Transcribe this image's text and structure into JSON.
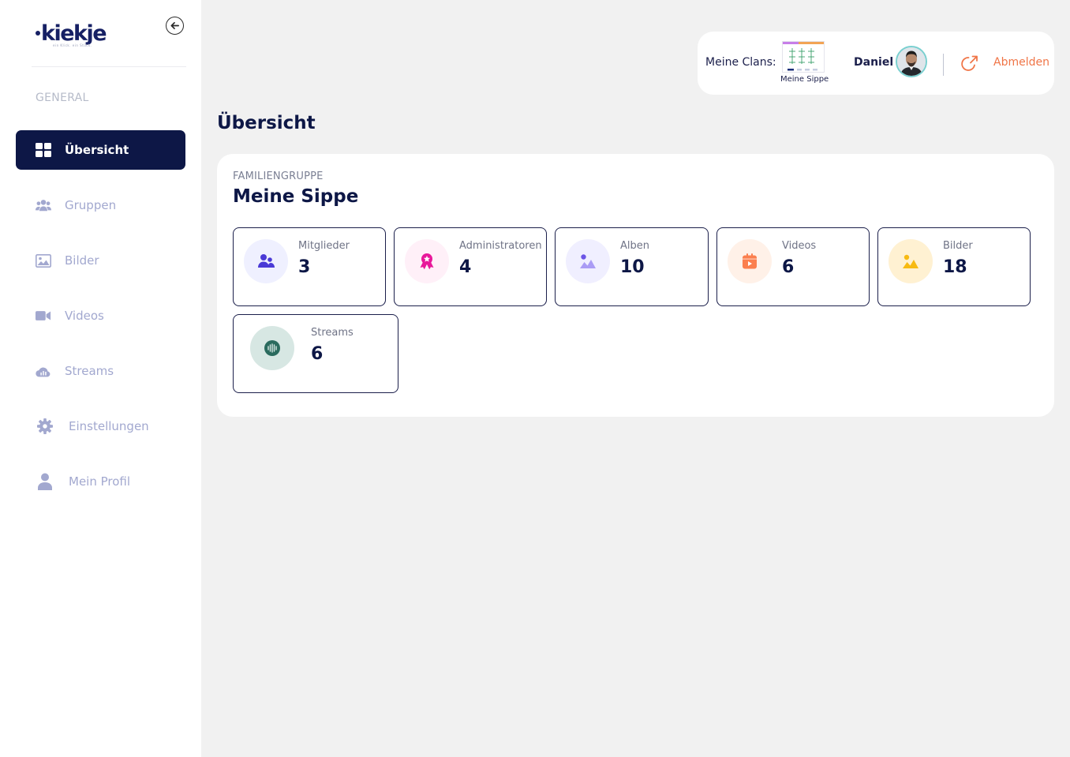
{
  "brand": {
    "name": "kiekje",
    "tagline": "ein Klick. ein Stück."
  },
  "sidebar": {
    "section_title": "GENERAL",
    "items": [
      {
        "label": "Übersicht",
        "icon": "dashboard-icon",
        "active": true
      },
      {
        "label": "Gruppen",
        "icon": "users-icon"
      },
      {
        "label": "Bilder",
        "icon": "image-icon"
      },
      {
        "label": "Videos",
        "icon": "video-camera-icon"
      },
      {
        "label": "Streams",
        "icon": "cloud-chart-icon"
      },
      {
        "label": "Einstellungen",
        "icon": "gear-icon"
      },
      {
        "label": "Mein Profil",
        "icon": "person-icon"
      }
    ]
  },
  "header": {
    "clans_label": "Meine Clans:",
    "clan_name": "Meine Sippe",
    "user_name": "Daniel",
    "logout_label": "Abmelden"
  },
  "main": {
    "page_title": "Übersicht",
    "group_type": "FAMILIENGRUPPE",
    "group_name": "Meine Sippe",
    "stats": [
      {
        "label": "Mitglieder",
        "value": "3",
        "icon": "users-icon",
        "color": "#4a3ad6",
        "bg": "#eff0ff"
      },
      {
        "label": "Administratoren",
        "value": "4",
        "icon": "award-icon",
        "color": "#e8189a",
        "bg": "#fff0f8"
      },
      {
        "label": "Alben",
        "value": "10",
        "icon": "album-icon",
        "color": "#8b78f0",
        "bg": "#f0efff"
      },
      {
        "label": "Videos",
        "value": "6",
        "icon": "video-calendar-icon",
        "color": "#fb7f4e",
        "bg": "#fff1e8"
      },
      {
        "label": "Bilder",
        "value": "18",
        "icon": "picture-icon",
        "color": "#f7ba12",
        "bg": "#fff1d2"
      },
      {
        "label": "Streams",
        "value": "6",
        "icon": "audio-wave-icon",
        "color": "#2a6b5e",
        "bg": "#d7e7e3"
      }
    ]
  },
  "colors": {
    "brand_navy": "#0d1746",
    "sidebar_text": "#a2a8cf",
    "logout_accent": "#f07547",
    "page_bg": "#f1f1f1"
  }
}
